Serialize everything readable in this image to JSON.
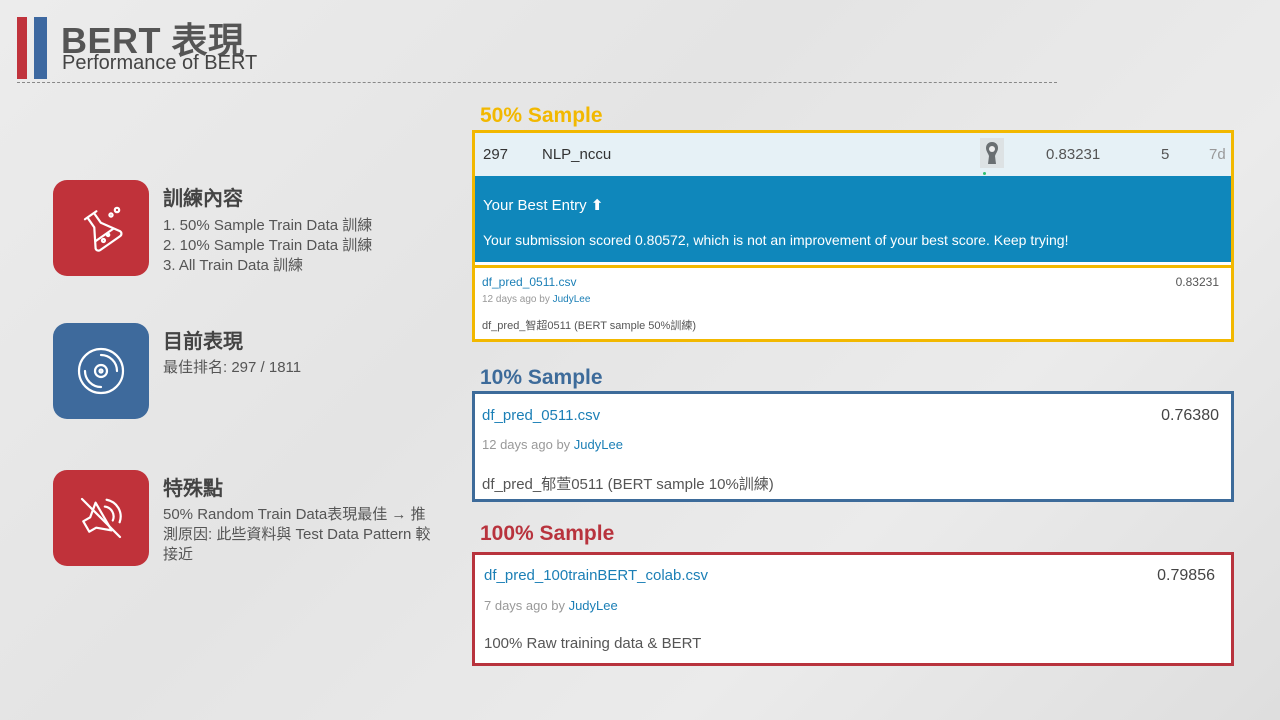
{
  "header": {
    "title": "BERT 表現",
    "subtitle": "Performance of BERT"
  },
  "features": [
    {
      "title": "訓練內容",
      "items": [
        "1.   50% Sample Train Data 訓練",
        "2.   10% Sample Train Data 訓練",
        "3.   All Train Data 訓練"
      ],
      "icon": "flask-icon"
    },
    {
      "title": "目前表現",
      "body": "最佳排名: 297 / 1811",
      "icon": "disc-icon"
    },
    {
      "title": "特殊點",
      "body": "50% Random Train Data表現最佳 →   推測原因: 此些資料與 Test Data Pattern 較接近",
      "icon": "speaker-off-icon"
    }
  ],
  "sections": {
    "s50": {
      "label": "50% Sample",
      "color": "#f2b800",
      "leaderboard": {
        "rank": "297",
        "team": "NLP_nccu",
        "score": "0.83231",
        "entries": "5",
        "last": "7d"
      },
      "best_entry": {
        "title": "Your Best Entry",
        "message": "Your submission scored 0.80572, which is not an improvement of your best score. Keep trying!"
      },
      "submission": {
        "file": "df_pred_0511.csv",
        "score": "0.83231",
        "meta_prefix": "12 days ago by ",
        "user": "JudyLee",
        "description": "df_pred_智超0511 (BERT sample 50%訓練)"
      }
    },
    "s10": {
      "label": "10% Sample",
      "color": "#3d6b9a",
      "submission": {
        "file": "df_pred_0511.csv",
        "score": "0.76380",
        "meta_prefix": "12 days ago by ",
        "user": "JudyLee",
        "description": "df_pred_郁萱0511 (BERT sample 10%訓練)"
      }
    },
    "s100": {
      "label": "100% Sample",
      "color": "#b8333d",
      "submission": {
        "file": "df_pred_100trainBERT_colab.csv",
        "score": "0.79856",
        "meta_prefix": "7 days ago by ",
        "user": "JudyLee",
        "description": "100% Raw training data & BERT"
      }
    }
  }
}
